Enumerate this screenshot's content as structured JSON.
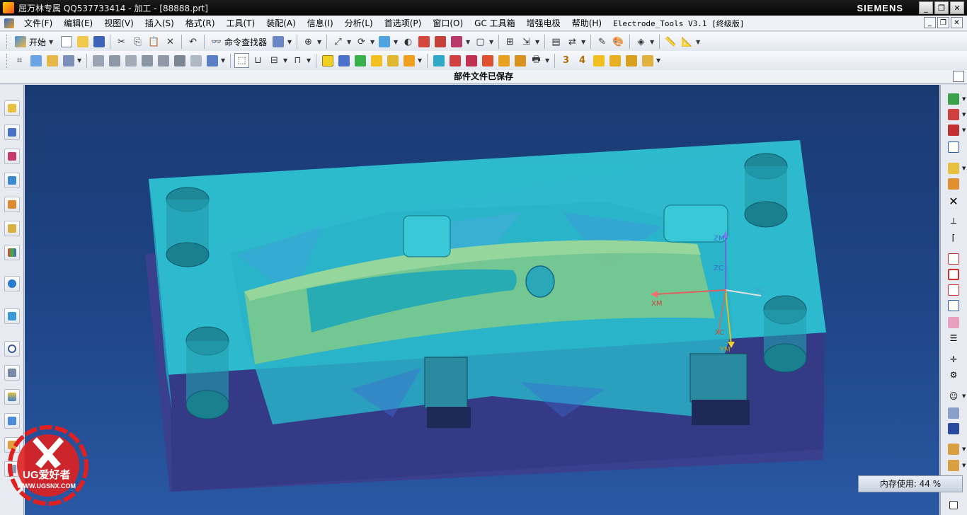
{
  "window": {
    "title": "屈万林专属 QQ537733414 - 加工 - [88888.prt]",
    "brand": "SIEMENS",
    "buttons": {
      "minimize": "_",
      "restore": "❐",
      "close": "✕"
    }
  },
  "menubar": {
    "items": [
      "文件(F)",
      "编辑(E)",
      "视图(V)",
      "插入(S)",
      "格式(R)",
      "工具(T)",
      "装配(A)",
      "信息(I)",
      "分析(L)",
      "首选项(P)",
      "窗口(O)",
      "GC 工具箱",
      "增强电极",
      "帮助(H)",
      "Electrode_Tools V3.1 [终级版]"
    ]
  },
  "toolbar": {
    "start_label": "开始",
    "command_finder_label": "命令查找器"
  },
  "cue_line": "部件文件已保存",
  "status": {
    "memory": "内存使用: 44 %"
  },
  "viewport": {
    "triad": {
      "zm": "ZM",
      "zc": "ZC",
      "xm": "XM",
      "yc": "YC",
      "xc": "XC",
      "ym": "YM"
    }
  },
  "watermark": {
    "text": "UG爱好者",
    "url": "WWW.UGSNX.COM"
  },
  "colors": {
    "background_top": "#1a3a72",
    "mold_cyan": "#2ec4d4",
    "mold_shadow": "#343a8a",
    "part_green": "#7dc98a"
  }
}
